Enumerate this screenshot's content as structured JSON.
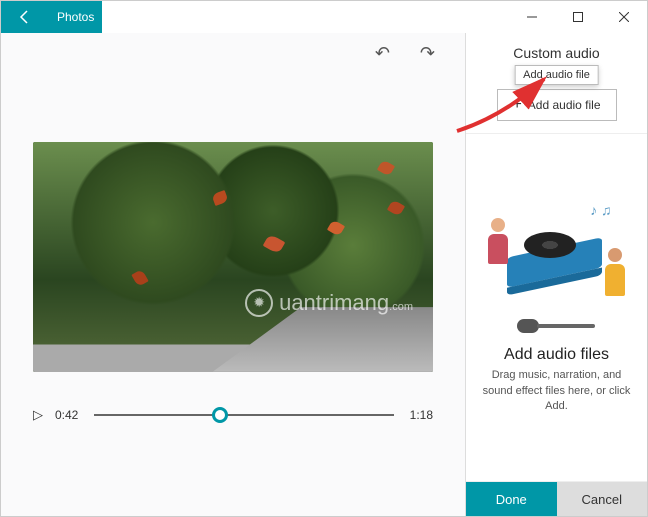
{
  "titlebar": {
    "app_name": "Photos"
  },
  "toolbar": {
    "undo": "↶",
    "redo": "↷"
  },
  "player": {
    "current_time": "0:42",
    "total_time": "1:18",
    "play_glyph": "▷"
  },
  "watermark": {
    "text": "uantrimang",
    "sub": ".com",
    "bulb": "✹"
  },
  "sidebar": {
    "section_heading": "Custom audio",
    "tooltip": "Add audio file",
    "add_label": "Add audio file",
    "empty_title": "Add audio files",
    "empty_desc": "Drag music, narration, and sound effect files here, or click Add."
  },
  "notes_glyph": "♪ ♫",
  "footer": {
    "done": "Done",
    "cancel": "Cancel"
  }
}
